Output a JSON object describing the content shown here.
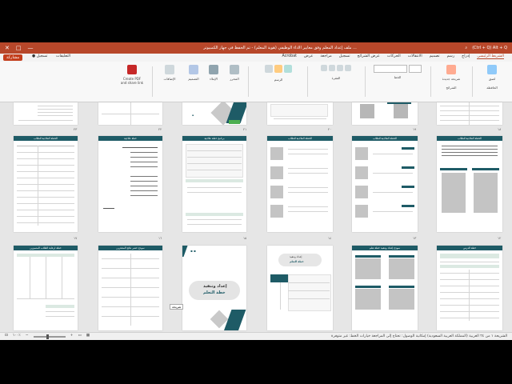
{
  "window": {
    "title": "ملف إعداد المعلم وفق معايير الأداء الوظيفي (هوية المعلم) - تم الحفظ في جهاز الكمبيوتر ...",
    "app_hint": "(Ctrl + Q) Alt + Q",
    "buttons": [
      "—",
      "□",
      "✕"
    ]
  },
  "menubar": {
    "tabs": [
      "الشريط الرئيسي",
      "إدراج",
      "رسم",
      "تصميم",
      "الانتقالات",
      "الحركات",
      "عرض الشرائح",
      "تسجيل",
      "مراجعة",
      "عرض",
      "Acrobat"
    ],
    "active_tab": "الشريط الرئيسي",
    "share_label": "مشاركة",
    "record_label": "تسجيل",
    "comments_label": "التعليقات"
  },
  "ribbon": {
    "groups": [
      {
        "label": "Create PDF and share link"
      },
      {
        "label": "الإضافات"
      },
      {
        "label": "التصميم"
      },
      {
        "label": "الإملاء"
      },
      {
        "label": "المحرر"
      },
      {
        "label": "الرسم"
      },
      {
        "label": "الفقرة"
      },
      {
        "label": "الخط"
      },
      {
        "label": "الشرائح"
      },
      {
        "label": "الحافظة"
      }
    ],
    "paste_label": "لصق",
    "new_slide_label": "شريحة جديدة"
  },
  "slides": {
    "row1_numbers": [
      "٢٣",
      "٢٢",
      "٢١",
      "٢٠",
      "١٩",
      "١٨"
    ],
    "row2_headers": [
      "الخطة العلاجية للطلاب",
      "خطة علاجية",
      "برنامج خطة علاجية",
      "الخطة العلاجية للطلاب",
      "الخطة العلاجية للطلاب",
      "الخطة العلاجية للطلاب"
    ],
    "row2_numbers": [
      "١٧",
      "١٦",
      "١٥",
      "١٤",
      "١٣",
      "١٢"
    ],
    "row3_headers": [
      "خطة لرعاية الطلاب المتميزين",
      "نموذج حصر نتائج المتعثرين",
      "",
      "",
      "نموذج إعداد وتنفيذ خطة تعلم",
      "خطة الدرس"
    ],
    "cover_title_line1": "إعداد وتنفيذ",
    "cover_title_line2": "خطة التعلم",
    "slide_tip": "شريحة"
  },
  "statusbar": {
    "left": "الشريحة ١ من ٢٤   العربية (المملكة العربية السعودية)   إمكانية الوصول: تحتاج إلى المراجعة   خيارات الخط: غير متوفرة",
    "zoom": "١٠٠٪"
  },
  "colors": {
    "accent": "#b7472a",
    "teal": "#1e5b66",
    "green": "#4caf50"
  }
}
